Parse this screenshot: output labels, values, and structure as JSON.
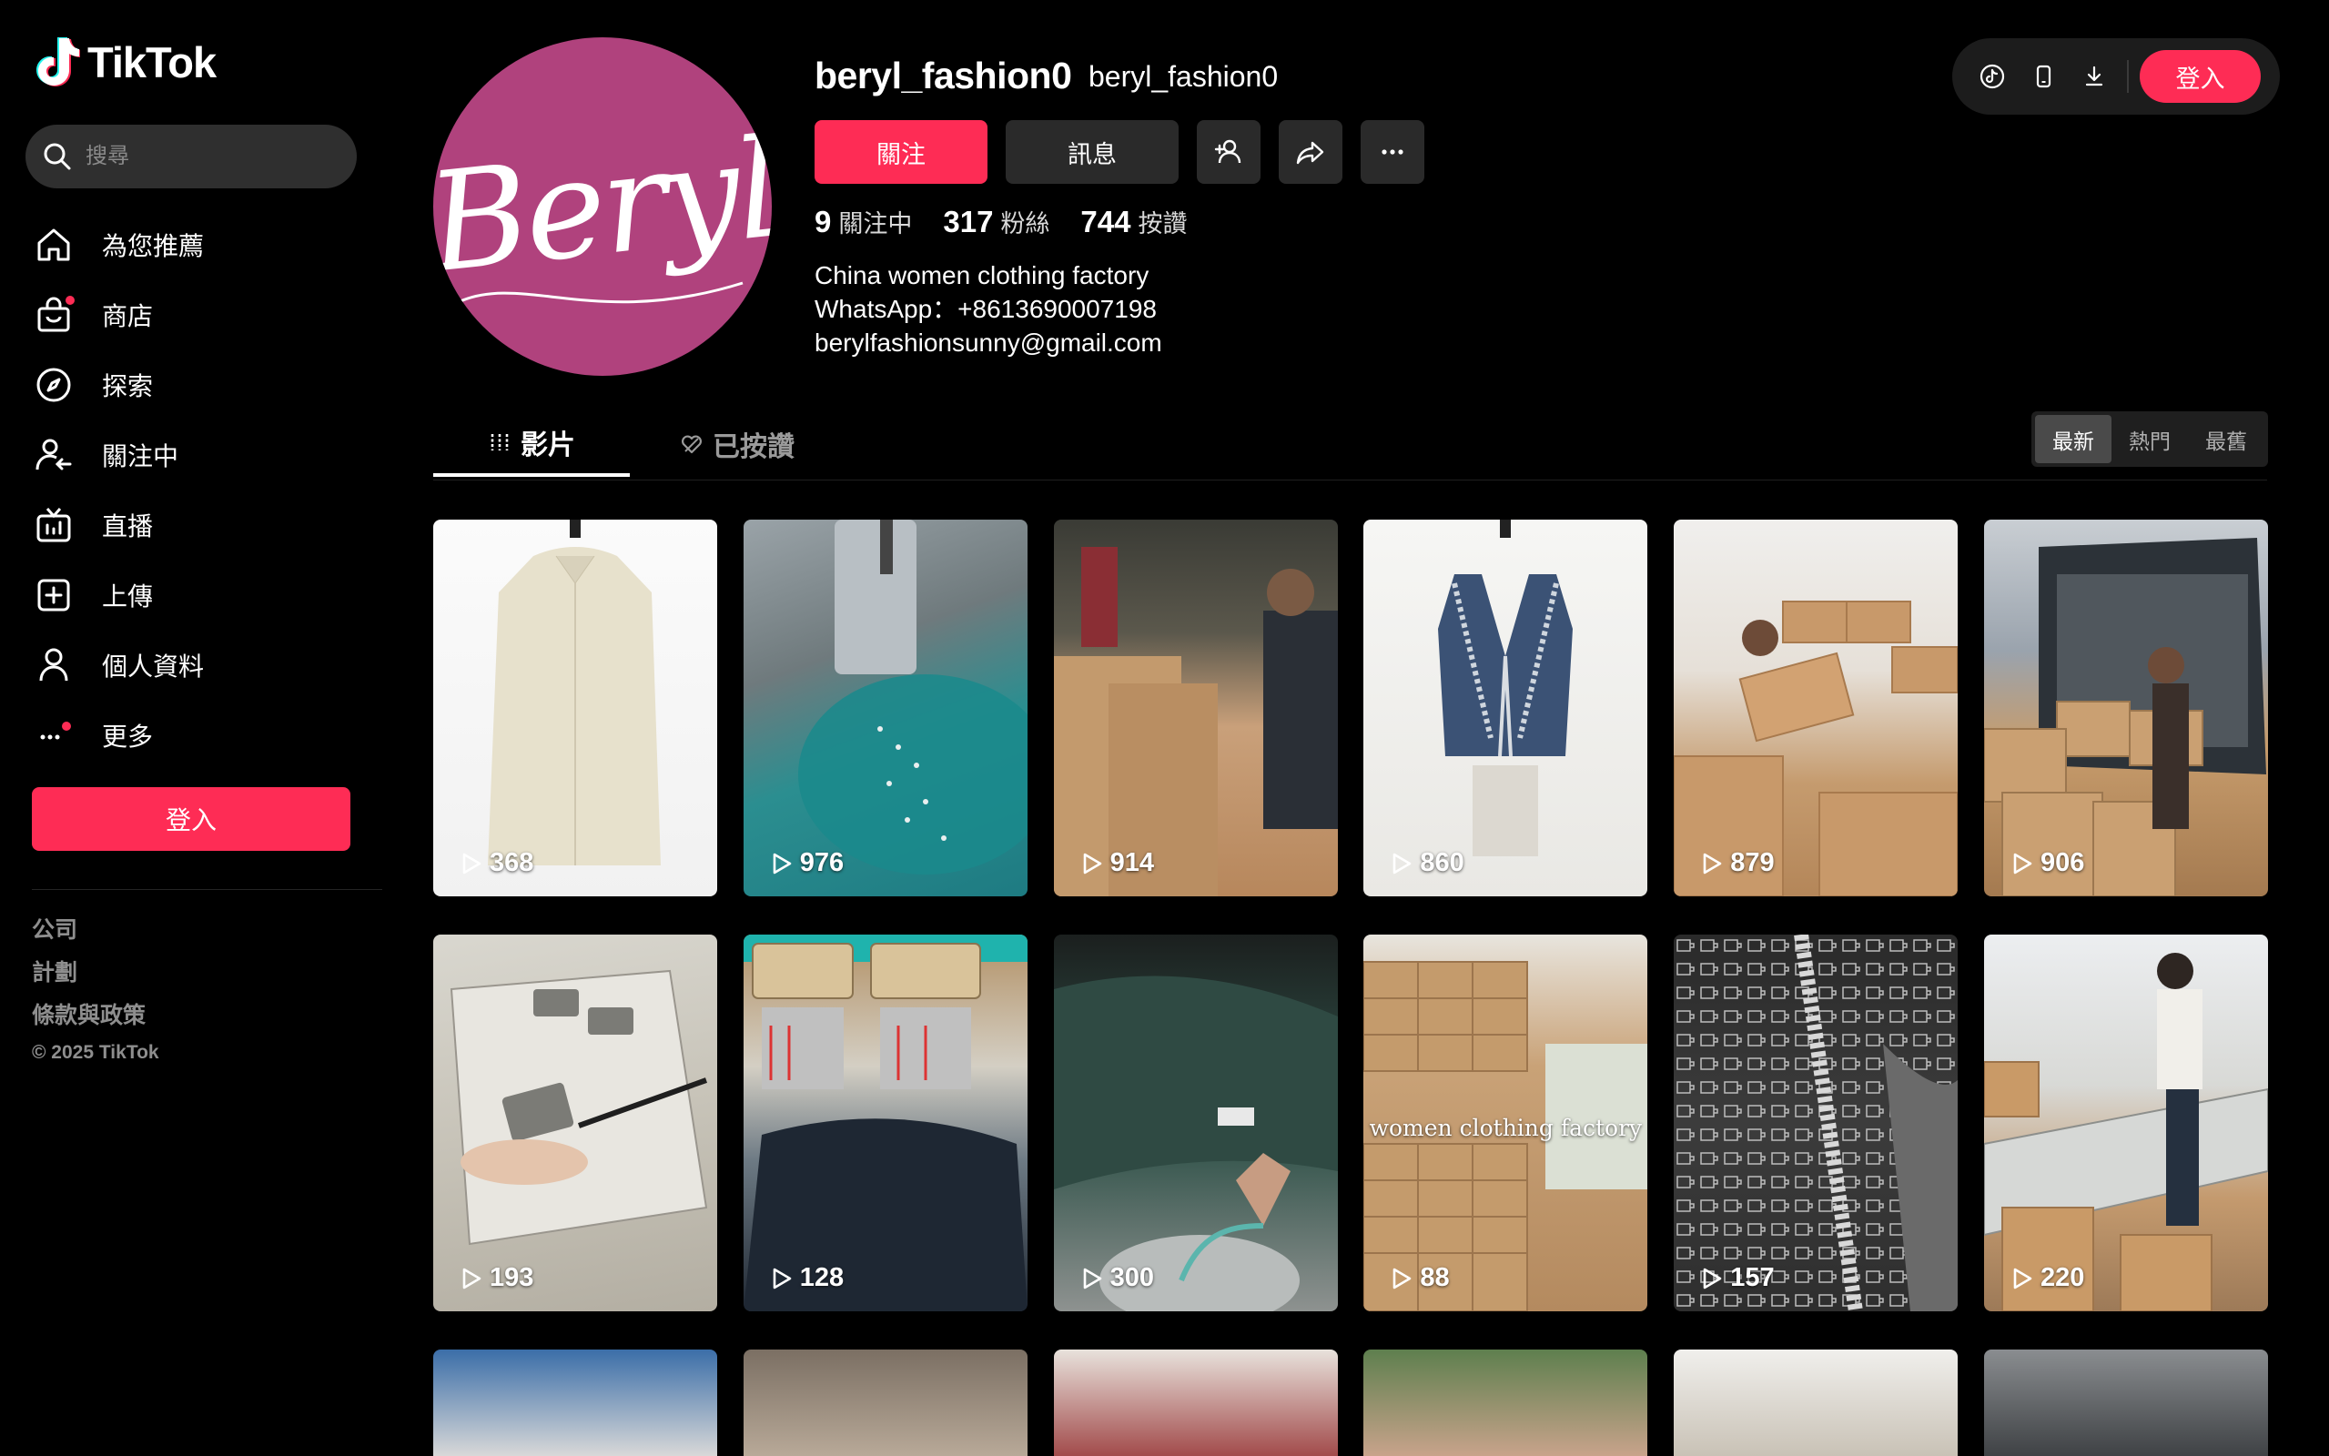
{
  "brand": {
    "name": "TikTok",
    "accent": "#fe2c55"
  },
  "search": {
    "placeholder": "搜尋"
  },
  "sidebar": {
    "items": [
      {
        "label": "為您推薦",
        "icon": "home-icon"
      },
      {
        "label": "商店",
        "icon": "shop-icon"
      },
      {
        "label": "探索",
        "icon": "explore-icon"
      },
      {
        "label": "關注中",
        "icon": "following-icon"
      },
      {
        "label": "直播",
        "icon": "live-icon"
      },
      {
        "label": "上傳",
        "icon": "upload-icon"
      },
      {
        "label": "個人資料",
        "icon": "profile-icon"
      },
      {
        "label": "更多",
        "icon": "more-icon"
      }
    ],
    "login_label": "登入",
    "footer": [
      "公司",
      "計劃",
      "條款與政策"
    ],
    "copyright": "© 2025 TikTok"
  },
  "toolbar": {
    "login_label": "登入",
    "icons": [
      "tiktok-icon",
      "phone-icon",
      "download-icon"
    ]
  },
  "profile": {
    "avatar_text": "Beryl",
    "handle": "beryl_fashion0",
    "nickname": "beryl_fashion0",
    "follow_label": "關注",
    "message_label": "訊息",
    "stats": [
      {
        "value": "9",
        "label": "關注中"
      },
      {
        "value": "317",
        "label": "粉絲"
      },
      {
        "value": "744",
        "label": "按讚"
      }
    ],
    "bio": [
      "China women clothing factory",
      "WhatsApp：+8613690007198",
      "berylfashionsunny@gmail.com"
    ]
  },
  "tabs": [
    {
      "label": "影片",
      "icon": "grid-icon"
    },
    {
      "label": "已按讚",
      "icon": "liked-heart-icon"
    }
  ],
  "sort": {
    "options": [
      "最新",
      "熱門",
      "最舊"
    ],
    "selected": "最新"
  },
  "videos": [
    {
      "views": "368"
    },
    {
      "views": "976"
    },
    {
      "views": "914"
    },
    {
      "views": "860"
    },
    {
      "views": "879"
    },
    {
      "views": "906"
    },
    {
      "views": "193"
    },
    {
      "views": "128"
    },
    {
      "views": "300"
    },
    {
      "views": "88",
      "caption": "women clothing factory"
    },
    {
      "views": "157"
    },
    {
      "views": "220"
    }
  ]
}
